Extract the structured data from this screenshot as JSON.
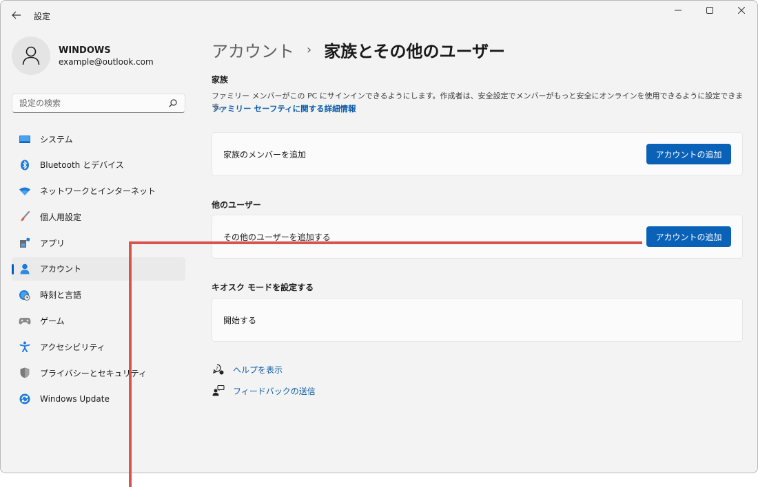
{
  "window": {
    "title": "設定"
  },
  "profile": {
    "name": "WINDOWS",
    "email": "example@outlook.com"
  },
  "search": {
    "placeholder": "設定の検索"
  },
  "sidebar": {
    "items": [
      {
        "label": "システム",
        "icon": "system-icon"
      },
      {
        "label": "Bluetooth とデバイス",
        "icon": "bluetooth-icon"
      },
      {
        "label": "ネットワークとインターネット",
        "icon": "network-icon"
      },
      {
        "label": "個人用設定",
        "icon": "brush-icon"
      },
      {
        "label": "アプリ",
        "icon": "apps-icon"
      },
      {
        "label": "アカウント",
        "icon": "account-icon",
        "active": true
      },
      {
        "label": "時刻と言語",
        "icon": "time-language-icon"
      },
      {
        "label": "ゲーム",
        "icon": "gamepad-icon"
      },
      {
        "label": "アクセシビリティ",
        "icon": "accessibility-icon"
      },
      {
        "label": "プライバシーとセキュリティ",
        "icon": "shield-icon"
      },
      {
        "label": "Windows Update",
        "icon": "update-icon"
      }
    ]
  },
  "breadcrumb": {
    "parent": "アカウント",
    "separator": "›",
    "current": "家族とその他のユーザー"
  },
  "family": {
    "title": "家族",
    "description": "ファミリー メンバーがこの PC にサインインできるようにします。作成者は、安全設定でメンバーがもっと安全にオンラインを使用できるように設定できます。",
    "link": "ファミリー セーフティに関する詳細情報",
    "card_label": "家族のメンバーを追加",
    "button": "アカウントの追加"
  },
  "other_users": {
    "title": "他のユーザー",
    "card_label": "その他のユーザーを追加する",
    "button": "アカウントの追加"
  },
  "kiosk": {
    "title": "キオスク モードを設定する",
    "card_label": "開始する"
  },
  "help": {
    "show_help": "ヘルプを表示",
    "feedback": "フィードバックの送信"
  },
  "colors": {
    "accent": "#0a62b8",
    "link": "#0a5ca8",
    "annotation": "#d9534f",
    "background": "#f3f3f3"
  }
}
